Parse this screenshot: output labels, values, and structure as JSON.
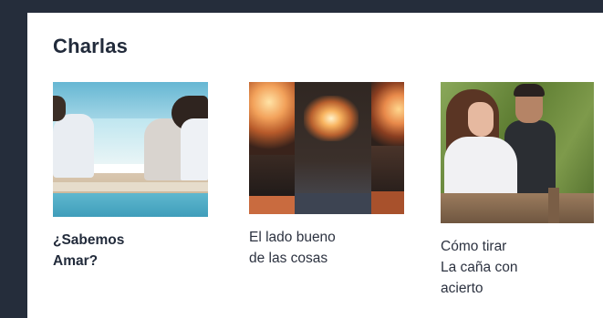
{
  "section": {
    "title": "Charlas"
  },
  "talks": [
    {
      "caption": "¿Sabemos\nAmar?",
      "image": "beach-couple-photo",
      "bold": true
    },
    {
      "caption": "El lado bueno\nde las cosas",
      "image": "candles-photo",
      "bold": false
    },
    {
      "caption": "Cómo tirar\nLa caña con\nacierto",
      "image": "couple-outdoors-photo",
      "bold": false
    }
  ],
  "colors": {
    "background": "#252d3b",
    "panel": "#ffffff",
    "title_text": "#222b3b"
  }
}
